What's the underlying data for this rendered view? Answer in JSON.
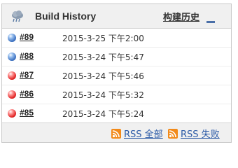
{
  "widget": {
    "title": "Build History",
    "title_cn": "构建历史",
    "icon": "cloud-weather-icon",
    "collapse_icon": "collapse-icon"
  },
  "builds": [
    {
      "number": "#89",
      "date": "2015-3-25 下午2:00",
      "status": "blue"
    },
    {
      "number": "#88",
      "date": "2015-3-24 下午5:47",
      "status": "blue"
    },
    {
      "number": "#87",
      "date": "2015-3-24 下午5:46",
      "status": "red"
    },
    {
      "number": "#86",
      "date": "2015-3-24 下午5:32",
      "status": "red"
    },
    {
      "number": "#85",
      "date": "2015-3-24 下午5:24",
      "status": "red"
    }
  ],
  "footer": {
    "rss_all": "RSS 全部",
    "rss_failed": "RSS 失败"
  },
  "colors": {
    "header_bg": "#f0f0f0",
    "link": "#2a59a6",
    "rss_orange": "#f28a1a"
  }
}
